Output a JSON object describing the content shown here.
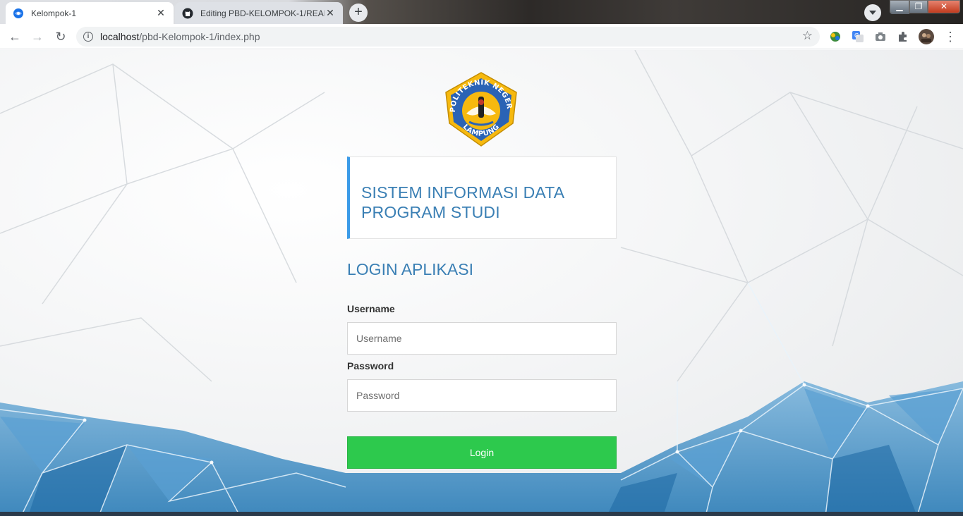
{
  "browser": {
    "tabs": [
      {
        "title": "Kelompok-1",
        "active": true,
        "favicon": "globe-icon"
      },
      {
        "title": "Editing PBD-KELOMPOK-1/READ",
        "active": false,
        "favicon": "github-icon"
      }
    ],
    "new_tab_label": "+",
    "close_glyph": "✕",
    "address": {
      "host": "localhost",
      "path": "/pbd-Kelompok-1/index.php"
    },
    "window_controls": {
      "minimize": "▁",
      "maximize": "❐",
      "close": "✕"
    }
  },
  "page": {
    "logo": {
      "top_text": "POLITEKNIK NEGERI",
      "bottom_text": "LAMPUNG",
      "colors": {
        "ring": "#2a63b5",
        "fill": "#f6b90f"
      }
    },
    "system_title": "SISTEM INFORMASI DATA PROGRAM STUDI",
    "login_heading": "LOGIN APLIKASI",
    "username": {
      "label": "Username",
      "placeholder": "Username",
      "value": ""
    },
    "password": {
      "label": "Password",
      "placeholder": "Password",
      "value": ""
    },
    "login_button": "Login"
  },
  "colors": {
    "accent_blue": "#3a7fb4",
    "card_border": "#3b9be8",
    "login_green": "#2dc94d"
  }
}
